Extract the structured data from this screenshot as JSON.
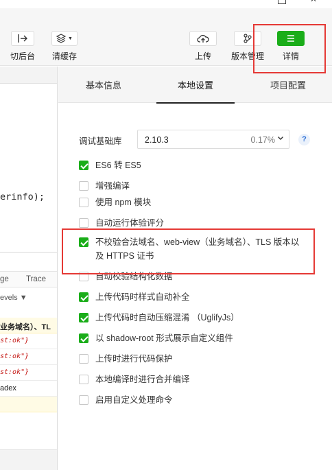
{
  "toolbar": {
    "switch_label": "切后台",
    "cache_label": "清缓存",
    "upload_label": "上传",
    "version_label": "版本管理",
    "details_label": "详情",
    "accent_color": "#1aad19",
    "highlight_color": "#e53935"
  },
  "editor": {
    "code_fragment": "erinfo);"
  },
  "console": {
    "tab_stage": "ge",
    "tab_trace": "Trace",
    "levels_label": "evels ▼",
    "log_rows": [
      "业务域名）、TL",
      "st:ok\"}",
      "st:ok\"}",
      "st:ok\"}",
      "adex"
    ]
  },
  "tabs": [
    {
      "label": "基本信息",
      "active": false
    },
    {
      "label": "本地设置",
      "active": true
    },
    {
      "label": "项目配置",
      "active": false
    }
  ],
  "base_library": {
    "label": "调试基础库",
    "version": "2.10.3",
    "percent": "0.17%",
    "help": "?"
  },
  "options": [
    {
      "label": "ES6 转 ES5",
      "checked": true
    },
    {
      "label": "增强编译",
      "checked": false
    },
    {
      "label": "使用 npm 模块",
      "checked": false
    },
    {
      "label": "自动运行体验评分",
      "checked": false
    },
    {
      "label": "不校验合法域名、web-view（业务域名）、TLS 版本以及 HTTPS 证书",
      "checked": true
    },
    {
      "label": "自动校验结构化数据",
      "checked": false
    },
    {
      "label": "上传代码时样式自动补全",
      "checked": true
    },
    {
      "label": "上传代码时自动压缩混淆 （UglifyJs）",
      "checked": true
    },
    {
      "label": "以 shadow-root 形式展示自定义组件",
      "checked": true
    },
    {
      "label": "上传时进行代码保护",
      "checked": false
    },
    {
      "label": "本地编译时进行合并编译",
      "checked": false
    },
    {
      "label": "启用自定义处理命令",
      "checked": false
    }
  ]
}
